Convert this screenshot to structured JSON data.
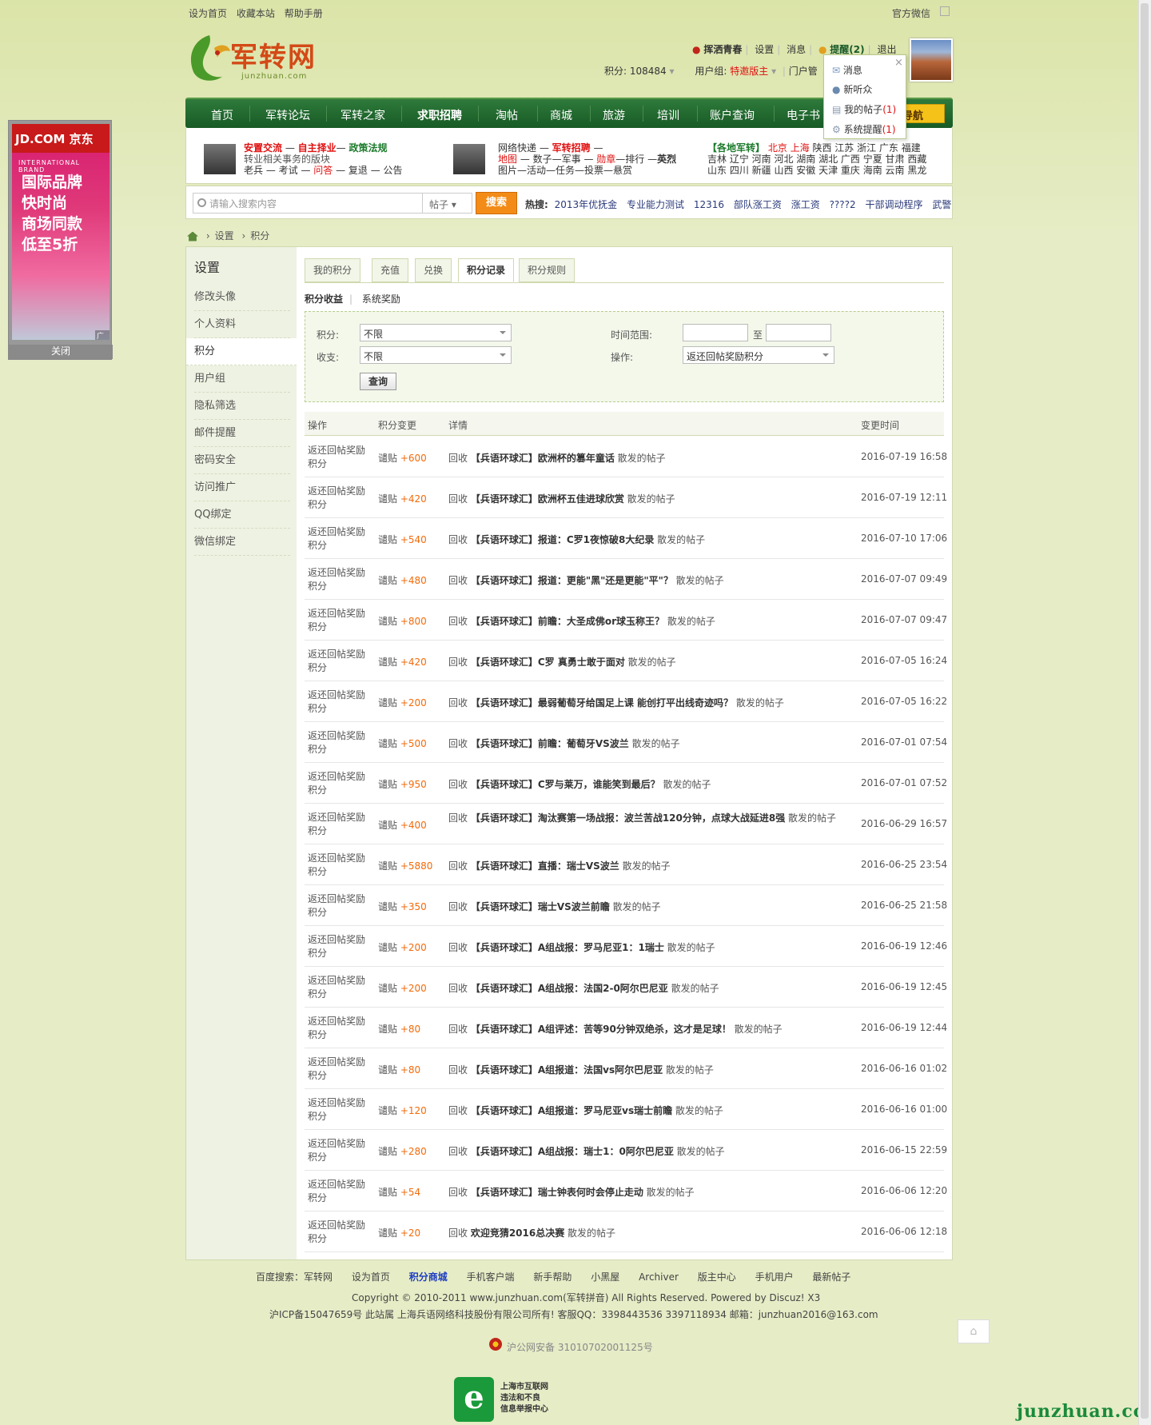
{
  "topbar": {
    "links": [
      "设为首页",
      "收藏本站",
      "帮助手册"
    ],
    "right": "官方微信"
  },
  "logo": {
    "text": "军转网",
    "sub": "junzhuan.com"
  },
  "user": {
    "name": "挥洒青春",
    "links": [
      "设置",
      "消息"
    ],
    "remind": "提醒(2)",
    "logout": "退出",
    "points_label": "积分: 108484",
    "group_label": "用户组: ",
    "group_value": "特邀版主",
    "portal": "门户管"
  },
  "dropdown": {
    "items": [
      "消息",
      "新听众",
      "我的帖子",
      "系统提醒"
    ],
    "counts": [
      "",
      "",
      "(1)",
      "(1)"
    ],
    "close": "×"
  },
  "nav": {
    "items": [
      "首页",
      "军转论坛",
      "军转之家",
      "求职招聘",
      "淘帖",
      "商城",
      "旅游",
      "培训",
      "账户查询",
      "电子书"
    ],
    "button": "导航"
  },
  "info": {
    "col1_line1": [
      "安置交流",
      " — ",
      "自主择业",
      "— ",
      "政策法规"
    ],
    "col1_line2": "转业相关事务的版块",
    "col1_line3": [
      "老兵 — 考试 — ",
      "问答",
      " — 复退 — 公告"
    ],
    "col2_line1": [
      "网络快递 — ",
      "军转招聘",
      " —"
    ],
    "col2_line2": [
      "地图",
      " — 数子—军事 — ",
      "勋章",
      "—排行 —",
      "英烈"
    ],
    "col2_line3": "图片—活动—任务—投票—悬赏",
    "col3_line1": [
      "【各地军转】",
      " 北京 上海",
      " 陕西 江苏 浙江 广东 福建"
    ],
    "col3_line2": "吉林 辽宁 河南 河北 湖南 湖北 广西 宁夏 甘肃 西藏",
    "col3_line3": "山东 四川 新疆 山西 安徽 天津 重庆 海南 云南 黑龙"
  },
  "search": {
    "placeholder": "请输入搜索内容",
    "type": "帖子",
    "button": "搜索",
    "hot_label": "热搜:",
    "hot": [
      "2013年优抚金",
      "专业能力测试",
      "12316",
      "部队涨工资",
      "涨工资",
      "????2",
      "干部调动程序",
      "武警"
    ]
  },
  "breadcrumb": {
    "items": [
      "设置",
      "积分"
    ]
  },
  "sidebar": {
    "title": "设置",
    "items": [
      "修改头像",
      "个人资料",
      "积分",
      "用户组",
      "隐私筛选",
      "邮件提醒",
      "密码安全",
      "访问推广",
      "QQ绑定",
      "微信绑定"
    ],
    "active": "积分"
  },
  "tabs": [
    "我的积分",
    "充值",
    "兑换",
    "积分记录",
    "积分规则"
  ],
  "subtabs": [
    "积分收益",
    "系统奖励"
  ],
  "filter": {
    "points_label": "积分:",
    "points_value": "不限",
    "flow_label": "收支:",
    "flow_value": "不限",
    "time_label": "时间范围:",
    "to": "至",
    "op_label": "操作:",
    "op_value": "返还回帖奖励积分",
    "query": "查询"
  },
  "table": {
    "headers": [
      "操作",
      "积分变更",
      "详情",
      "变更时间"
    ],
    "rows": [
      {
        "op": "返还回帖奖励积分",
        "unit": "谴贴",
        "val": "+600",
        "pre": "回收 ",
        "title": "【兵语环球汇】欧洲杯的篡年童话",
        "post": " 散发的帖子",
        "time": "2016-07-19 16:58"
      },
      {
        "op": "返还回帖奖励积分",
        "unit": "谴贴",
        "val": "+420",
        "pre": "回收 ",
        "title": "【兵语环球汇】欧洲杯五佳进球欣赏",
        "post": " 散发的帖子",
        "time": "2016-07-19 12:11"
      },
      {
        "op": "返还回帖奖励积分",
        "unit": "谴贴",
        "val": "+540",
        "pre": "回收 ",
        "title": "【兵语环球汇】报道：C罗1夜惊破8大纪录",
        "post": " 散发的帖子",
        "time": "2016-07-10 17:06"
      },
      {
        "op": "返还回帖奖励积分",
        "unit": "谴贴",
        "val": "+480",
        "pre": "回收 ",
        "title": "【兵语环球汇】报道：更能\"黑\"还是更能\"平\"？",
        "post": " 散发的帖子",
        "time": "2016-07-07 09:49"
      },
      {
        "op": "返还回帖奖励积分",
        "unit": "谴贴",
        "val": "+800",
        "pre": "回收 ",
        "title": "【兵语环球汇】前瞻：大圣成佛or球玉称王？",
        "post": " 散发的帖子",
        "time": "2016-07-07 09:47"
      },
      {
        "op": "返还回帖奖励积分",
        "unit": "谴贴",
        "val": "+420",
        "pre": "回收 ",
        "title": "【兵语环球汇】C罗 真勇士敢于面对",
        "post": " 散发的帖子",
        "time": "2016-07-05 16:24"
      },
      {
        "op": "返还回帖奖励积分",
        "unit": "谴贴",
        "val": "+200",
        "pre": "回收 ",
        "title": "【兵语环球汇】最弱葡萄牙给国足上课 能创打平出线奇迹吗？",
        "post": " 散发的帖子",
        "time": "2016-07-05 16:22"
      },
      {
        "op": "返还回帖奖励积分",
        "unit": "谴贴",
        "val": "+500",
        "pre": "回收 ",
        "title": "【兵语环球汇】前瞻：葡萄牙VS波兰",
        "post": " 散发的帖子",
        "time": "2016-07-01 07:54"
      },
      {
        "op": "返还回帖奖励积分",
        "unit": "谴贴",
        "val": "+950",
        "pre": "回收 ",
        "title": "【兵语环球汇】C罗与莱万，谁能笑到最后？",
        "post": " 散发的帖子",
        "time": "2016-07-01 07:52"
      },
      {
        "op": "返还回帖奖励积分",
        "unit": "谴贴",
        "val": "+400",
        "pre": "回收 ",
        "title": "【兵语环球汇】淘汰赛第一场战报：波兰苦战120分钟，点球大战延进8强",
        "post": " 散发的帖子",
        "time": "2016-06-29 16:57",
        "wrap": true
      },
      {
        "op": "返还回帖奖励积分",
        "unit": "谴贴",
        "val": "+5880",
        "pre": "回收 ",
        "title": "【兵语环球汇】直播：瑞士VS波兰",
        "post": " 散发的帖子",
        "time": "2016-06-25 23:54"
      },
      {
        "op": "返还回帖奖励积分",
        "unit": "谴贴",
        "val": "+350",
        "pre": "回收 ",
        "title": "【兵语环球汇】瑞士VS波兰前瞻",
        "post": " 散发的帖子",
        "time": "2016-06-25 21:58"
      },
      {
        "op": "返还回帖奖励积分",
        "unit": "谴贴",
        "val": "+200",
        "pre": "回收 ",
        "title": "【兵语环球汇】A组战报：罗马尼亚1：1瑞士",
        "post": " 散发的帖子",
        "time": "2016-06-19 12:46"
      },
      {
        "op": "返还回帖奖励积分",
        "unit": "谴贴",
        "val": "+200",
        "pre": "回收 ",
        "title": "【兵语环球汇】A组战报：法国2-0阿尔巴尼亚",
        "post": " 散发的帖子",
        "time": "2016-06-19 12:45"
      },
      {
        "op": "返还回帖奖励积分",
        "unit": "谴贴",
        "val": "+80",
        "pre": "回收 ",
        "title": "【兵语环球汇】A组评述：苦等90分钟双绝杀，这才是足球！",
        "post": " 散发的帖子",
        "time": "2016-06-19 12:44"
      },
      {
        "op": "返还回帖奖励积分",
        "unit": "谴贴",
        "val": "+80",
        "pre": "回收 ",
        "title": "【兵语环球汇】A组报道：法国vs阿尔巴尼亚",
        "post": " 散发的帖子",
        "time": "2016-06-16 01:02"
      },
      {
        "op": "返还回帖奖励积分",
        "unit": "谴贴",
        "val": "+120",
        "pre": "回收 ",
        "title": "【兵语环球汇】A组报道：罗马尼亚vs瑞士前瞻",
        "post": " 散发的帖子",
        "time": "2016-06-16 01:00"
      },
      {
        "op": "返还回帖奖励积分",
        "unit": "谴贴",
        "val": "+280",
        "pre": "回收 ",
        "title": "【兵语环球汇】A组战报：瑞士1：0阿尔巴尼亚",
        "post": " 散发的帖子",
        "time": "2016-06-15 22:59"
      },
      {
        "op": "返还回帖奖励积分",
        "unit": "谴贴",
        "val": "+54",
        "pre": "回收 ",
        "title": "【兵语环球汇】瑞士钟表何时会停止走动",
        "post": " 散发的帖子",
        "time": "2016-06-06 12:20"
      },
      {
        "op": "返还回帖奖励积分",
        "unit": "谴贴",
        "val": "+20",
        "pre": "回收 ",
        "title": "欢迎竞猜2016总决赛",
        "post": " 散发的帖子",
        "time": "2016-06-06 12:18"
      }
    ]
  },
  "footer": {
    "links": [
      "百度搜索：军转网",
      "设为首页",
      "积分商城",
      "手机客户端",
      "新手帮助",
      "小黑屋",
      "Archiver",
      "版主中心",
      "手机用户",
      "最新帖子"
    ],
    "copyright": "Copyright © 2010-2011 www.junzhuan.com(军转拼音) All Rights Reserved. Powered by Discuz! X3",
    "icp": "沪ICP备15047659号 此站属 上海兵语网络科技股份有限公司所有!     客服QQ：3398443536 3397118934 邮箱：junzhuan2016@163.com",
    "police": "沪公网安备 31010702001125号",
    "badge_lines": [
      "上海市互联网",
      "违法和不良",
      "信息举报中心"
    ]
  },
  "ad": {
    "top": "JD.COM 京东",
    "brand": "INTERNATIONAL BRAND",
    "lines": [
      "国际品牌",
      "快时尚",
      "商场同款",
      "低至5折"
    ],
    "tag": "广告",
    "close": "关闭"
  },
  "watermark": "junzhuan.com"
}
